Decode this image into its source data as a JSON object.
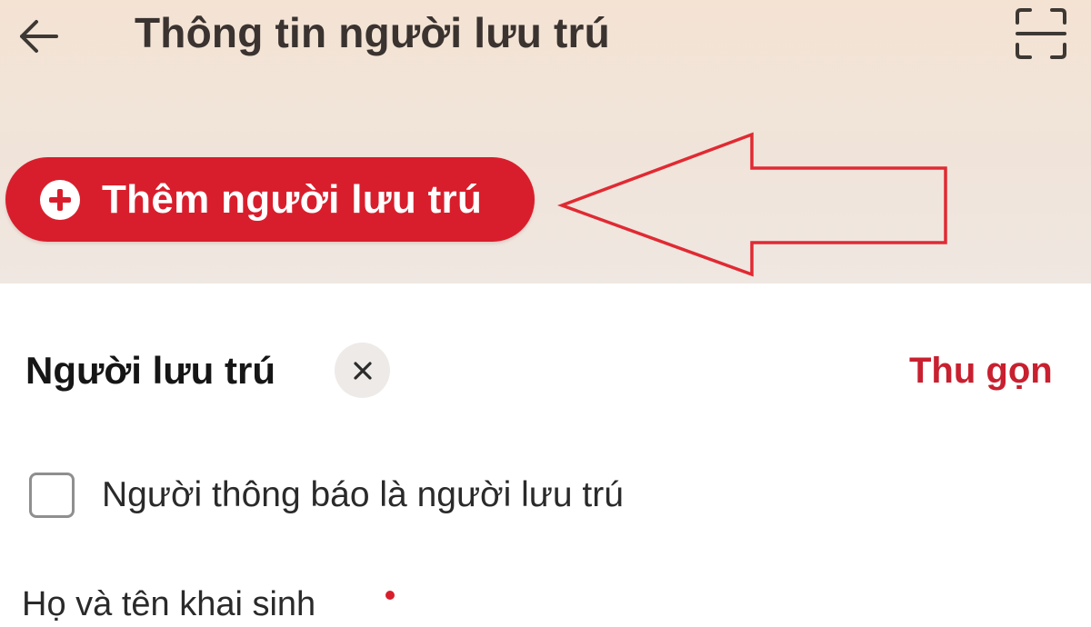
{
  "header": {
    "title": "Thông tin người lưu trú",
    "back_icon": "arrow-left-icon",
    "scan_icon": "scan-frame-icon"
  },
  "add_button": {
    "label": "Thêm người lưu trú",
    "icon": "plus-circle-icon"
  },
  "annotation": {
    "icon": "red-arrow-pointer-icon",
    "color": "#e02a33"
  },
  "section": {
    "title": "Người lưu trú",
    "close_icon": "close-icon",
    "collapse_label": "Thu gọn"
  },
  "checkbox": {
    "label": "Người thông báo là người lưu trú",
    "checked": false
  },
  "field": {
    "label": "Họ và tên khai sinh",
    "required": true
  },
  "colors": {
    "accent": "#d81e2c",
    "header_bg": "#f4e3d3",
    "title_text": "#3a3330"
  }
}
